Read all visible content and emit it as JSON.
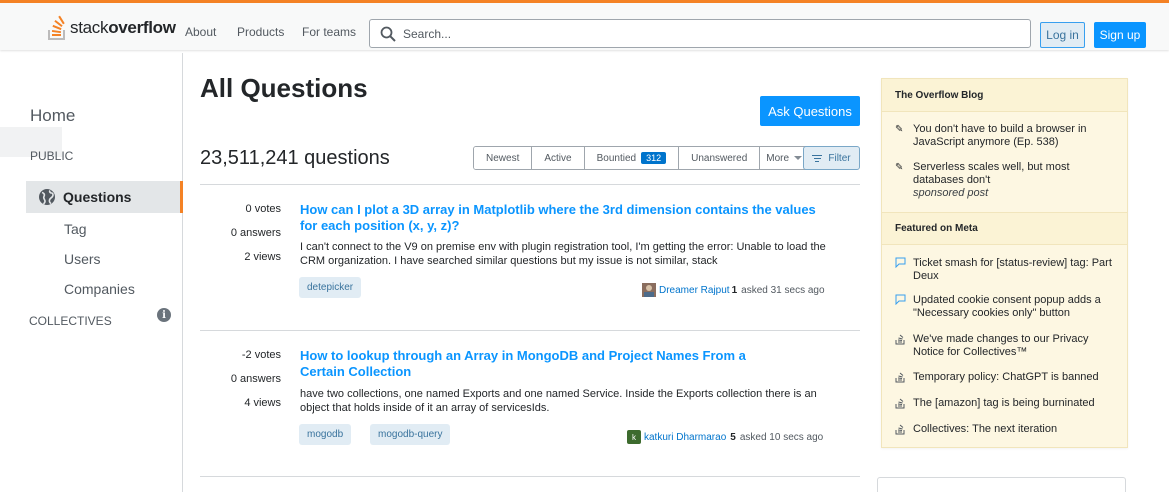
{
  "header": {
    "logo_light": "stack",
    "logo_bold": "overflow",
    "nav": [
      "About",
      "Products",
      "For teams"
    ],
    "search_placeholder": "Search...",
    "login_label": "Log in",
    "signup_label": "Sign up"
  },
  "sidebar": {
    "home": "Home",
    "public": "PUBLIC",
    "questions": "Questions",
    "tag": "Tag",
    "users": "Users",
    "companies": "Companies",
    "collectives": "COLLECTIVES"
  },
  "main": {
    "title": "All Questions",
    "ask_label": "Ask Questions",
    "count": "23,511,241 questions",
    "filters": {
      "newest": "Newest",
      "active": "Active",
      "bountied": "Bountied",
      "bountied_count": "312",
      "unanswered": "Unanswered",
      "more": "More"
    },
    "filter_label": "Filter",
    "questions": [
      {
        "votes": "0 votes",
        "answers": "0 answers",
        "views": "2 views",
        "title": "How can I plot a 3D array in Matplotlib where the 3rd dimension contains the values for each position (x, y, z)?",
        "excerpt": "I can't connect to the V9 on premise env with plugin registration tool, I'm getting the error: Unable to load the CRM organization. I have searched similar questions but my issue is not similar, stack",
        "tags": [
          "detepicker"
        ],
        "user": "Dreamer Rajput",
        "rep": "1",
        "asked": "asked 31 secs ago"
      },
      {
        "votes": "-2 votes",
        "answers": "0 answers",
        "views": "4 views",
        "title": "How to lookup through an Array in MongoDB and Project Names From a Certain Collection",
        "excerpt": "have two collections, one named Exports and one named Service. Inside the Exports collection there is an object that holds inside of it an array of servicesIds.",
        "tags": [
          "mogodb",
          "mogodb-query"
        ],
        "user": "katkuri Dharmarao",
        "rep": "5",
        "asked": "asked 10 secs ago",
        "avatar_letter": "k"
      }
    ]
  },
  "right": {
    "blog_title": "The Overflow Blog",
    "blog_items": [
      "You don't have to build a browser in JavaScript anymore (Ep. 538)",
      "Serverless scales well, but most databases don't"
    ],
    "sponsored": "sponsored post",
    "meta_title": "Featured on Meta",
    "meta_items": [
      "Ticket smash for [status-review] tag: Part Deux",
      "Updated cookie consent popup adds a \"Necessary cookies only\" button",
      "We've made changes to our Privacy Notice for Collectives™",
      "Temporary policy: ChatGPT is banned",
      "The [amazon] tag is being burninated",
      "Collectives: The next iteration"
    ]
  },
  "colors": {
    "accent": "#f48225",
    "link": "#0a95ff",
    "primary_button": "#0a95ff"
  },
  "icons": [
    "stackoverflow-logo-icon",
    "search-icon",
    "globe-icon",
    "info-icon",
    "pencil-icon",
    "chat-bubble-icon",
    "stack-icon"
  ]
}
